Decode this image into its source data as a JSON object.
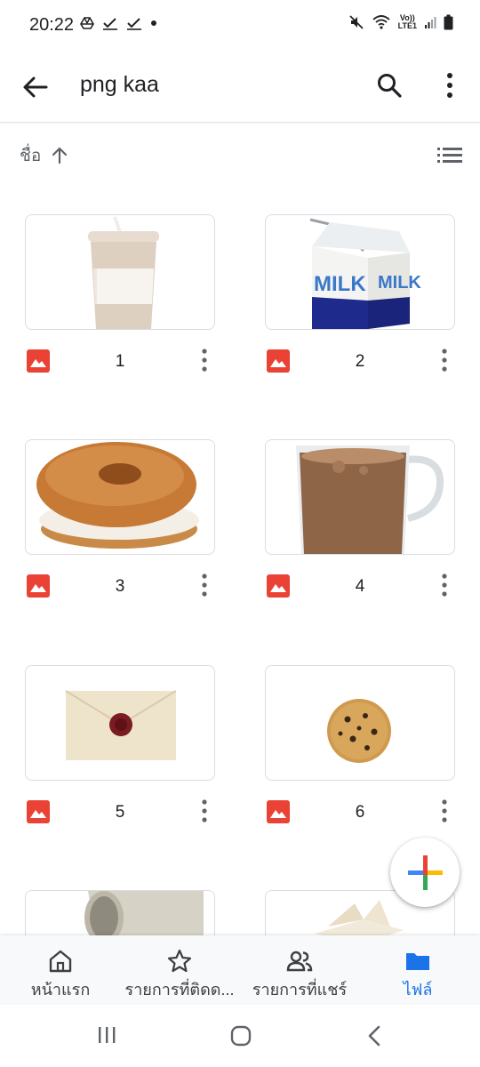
{
  "status_bar": {
    "time": "20:22",
    "lte_top": "Vo))",
    "lte_bottom": "LTE1"
  },
  "app_bar": {
    "title": "png kaa",
    "back_icon": "arrow-back-icon",
    "search_icon": "search-icon",
    "more_icon": "more-vert-icon"
  },
  "sort": {
    "label": "ชื่อ",
    "direction_icon": "arrow-up-icon",
    "view_icon": "list-view-icon"
  },
  "files": [
    {
      "name": "1",
      "thumbnail": "coffee-cup"
    },
    {
      "name": "2",
      "thumbnail": "milk-carton"
    },
    {
      "name": "3",
      "thumbnail": "bagel"
    },
    {
      "name": "4",
      "thumbnail": "chocolate-drink"
    },
    {
      "name": "5",
      "thumbnail": "envelope"
    },
    {
      "name": "6",
      "thumbnail": "cookie"
    },
    {
      "name": "",
      "thumbnail": "mug"
    },
    {
      "name": "",
      "thumbnail": "book"
    }
  ],
  "thumb_texts": {
    "milk_left": "MILK",
    "milk_right": "MILK"
  },
  "fab": {
    "icon": "add-icon"
  },
  "bottom_nav": {
    "items": [
      {
        "label": "หน้าแรก",
        "icon": "home-icon"
      },
      {
        "label": "รายการที่ติดด...",
        "icon": "star-icon"
      },
      {
        "label": "รายการที่แชร์",
        "icon": "people-icon"
      },
      {
        "label": "ไฟล์",
        "icon": "folder-icon",
        "active": true
      }
    ]
  },
  "colors": {
    "accent": "#1a73e8",
    "image_icon": "#ea4335",
    "text_primary": "#202124",
    "text_secondary": "#5f6368"
  }
}
